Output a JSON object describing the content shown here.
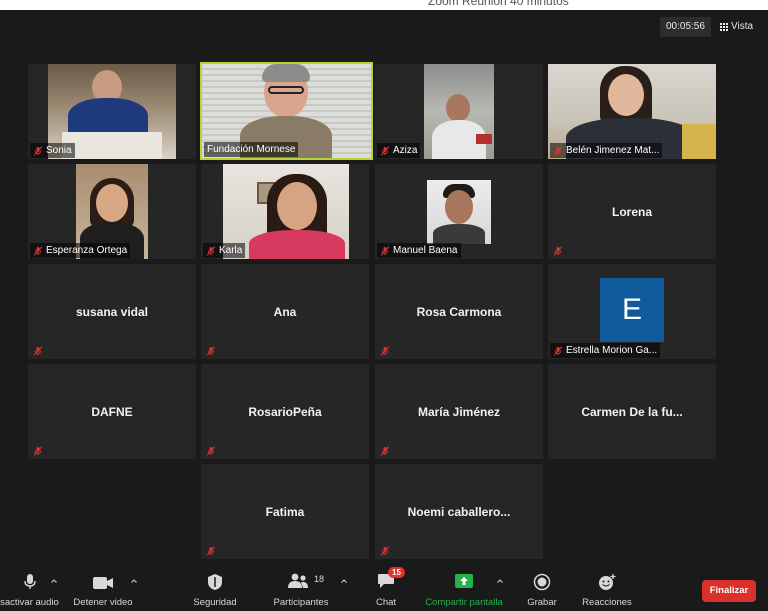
{
  "window": {
    "title": "Zoom Reunión 40 minutos"
  },
  "topbar": {
    "timer": "00:05:56",
    "view_label": "Vista"
  },
  "participants": {
    "sonia": "Sonia",
    "fundacion": "Fundación Mornese",
    "aziza": "Aziza",
    "belen": "Belén Jimenez Mat...",
    "esperanza": "Esperanza Ortega",
    "karla": "Karla",
    "manuel": "Manuel Baena",
    "lorena": "Lorena",
    "susana": "susana vidal",
    "ana": "Ana",
    "rosa": "Rosa Carmona",
    "estrella": "Estrella Morion Ga...",
    "estrella_initial": "E",
    "dafne": "DAFNE",
    "rosario": "RosarioPeña",
    "maria": "María Jiménez",
    "carmen": "Carmen De la fu...",
    "fatima": "Fatima",
    "noemi": "Noemi  caballero..."
  },
  "toolbar": {
    "mute_label": "Desactivar audio",
    "video_label": "Detener video",
    "security_label": "Seguridad",
    "participants_label": "Participantes",
    "participants_count": "18",
    "chat_label": "Chat",
    "chat_badge": "15",
    "share_label": "Compartir pantalla",
    "record_label": "Grabar",
    "reactions_label": "Reacciones",
    "end_label": "Finalizar"
  },
  "colors": {
    "active_speaker_border": "#b6d636",
    "share_green": "#22b24c",
    "end_red": "#d9312b",
    "muted_red": "#e0312b",
    "avatar_blue": "#0e5a9a"
  },
  "icons": [
    "microphone-icon",
    "video-camera-icon",
    "shield-icon",
    "participants-icon",
    "chat-bubble-icon",
    "share-screen-icon",
    "record-icon",
    "reactions-icon",
    "muted-mic-icon",
    "grid-view-icon",
    "chevron-up-icon"
  ]
}
